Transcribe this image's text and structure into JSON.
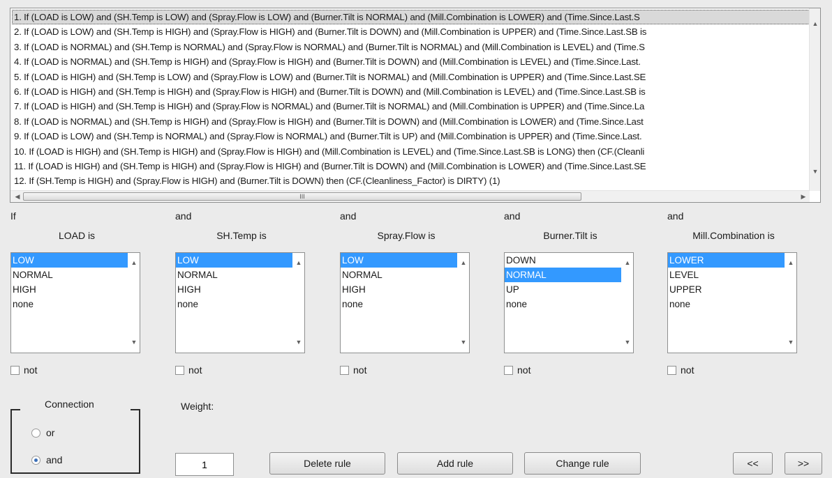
{
  "rules": [
    "1. If (LOAD is LOW) and (SH.Temp is LOW) and (Spray.Flow is LOW) and (Burner.Tilt is NORMAL) and (Mill.Combination is LOWER) and (Time.Since.Last.S",
    "2. If (LOAD is LOW) and (SH.Temp is HIGH) and (Spray.Flow is HIGH) and (Burner.Tilt is DOWN) and (Mill.Combination is UPPER) and (Time.Since.Last.SB is",
    "3. If (LOAD is NORMAL) and (SH.Temp is NORMAL) and (Spray.Flow is NORMAL) and (Burner.Tilt is NORMAL) and (Mill.Combination is LEVEL) and (Time.S",
    "4. If (LOAD is NORMAL) and (SH.Temp is HIGH) and (Spray.Flow is HIGH) and (Burner.Tilt is DOWN) and (Mill.Combination is LEVEL) and (Time.Since.Last.",
    "5. If (LOAD is HIGH) and (SH.Temp is LOW) and (Spray.Flow is LOW) and (Burner.Tilt is NORMAL) and (Mill.Combination is UPPER) and (Time.Since.Last.SE",
    "6. If (LOAD is HIGH) and (SH.Temp is HIGH) and (Spray.Flow is HIGH) and (Burner.Tilt is DOWN) and (Mill.Combination is LEVEL) and (Time.Since.Last.SB is",
    "7. If (LOAD is HIGH) and (SH.Temp is HIGH) and (Spray.Flow is NORMAL) and (Burner.Tilt is NORMAL) and (Mill.Combination is UPPER) and (Time.Since.La",
    "8. If (LOAD is NORMAL) and (SH.Temp is HIGH) and (Spray.Flow is HIGH) and (Burner.Tilt is DOWN) and (Mill.Combination is LOWER) and (Time.Since.Last",
    "9. If (LOAD is LOW) and (SH.Temp is NORMAL) and (Spray.Flow is NORMAL) and (Burner.Tilt is UP) and (Mill.Combination is UPPER) and (Time.Since.Last.",
    "10. If (LOAD is HIGH) and (SH.Temp is HIGH) and (Spray.Flow is HIGH) and (Mill.Combination is LEVEL) and (Time.Since.Last.SB is LONG) then (CF.(Cleanli",
    "11. If (LOAD is HIGH) and (SH.Temp is HIGH) and (Spray.Flow is HIGH) and (Burner.Tilt is DOWN) and (Mill.Combination is LOWER) and (Time.Since.Last.SE",
    "12. If (SH.Temp is HIGH) and (Spray.Flow is HIGH) and (Burner.Tilt is DOWN) then (CF.(Cleanliness_Factor) is DIRTY) (1)"
  ],
  "selected_rule": 0,
  "columns": [
    {
      "conj": "If",
      "label": "LOAD is",
      "options": [
        "LOW",
        "NORMAL",
        "HIGH",
        "none"
      ],
      "selected": 0,
      "not_label": "not"
    },
    {
      "conj": "and",
      "label": "SH.Temp is",
      "options": [
        "LOW",
        "NORMAL",
        "HIGH",
        "none"
      ],
      "selected": 0,
      "not_label": "not"
    },
    {
      "conj": "and",
      "label": "Spray.Flow is",
      "options": [
        "LOW",
        "NORMAL",
        "HIGH",
        "none"
      ],
      "selected": 0,
      "not_label": "not"
    },
    {
      "conj": "and",
      "label": "Burner.Tilt is",
      "options": [
        "DOWN",
        "NORMAL",
        "UP",
        "none"
      ],
      "selected": 1,
      "not_label": "not"
    },
    {
      "conj": "and",
      "label": "Mill.Combination is",
      "options": [
        "LOWER",
        "LEVEL",
        "UPPER",
        "none"
      ],
      "selected": 0,
      "not_label": "not"
    }
  ],
  "connection": {
    "title": "Connection",
    "options": [
      "or",
      "and"
    ],
    "selected": "and"
  },
  "weight": {
    "label": "Weight:",
    "value": "1"
  },
  "buttons": {
    "delete": "Delete rule",
    "add": "Add rule",
    "change": "Change rule",
    "prev": "<<",
    "next": ">>"
  },
  "scroll_glyphs": {
    "up": "▲",
    "down": "▼",
    "left": "◀",
    "right": "▶",
    "grip": "III"
  }
}
